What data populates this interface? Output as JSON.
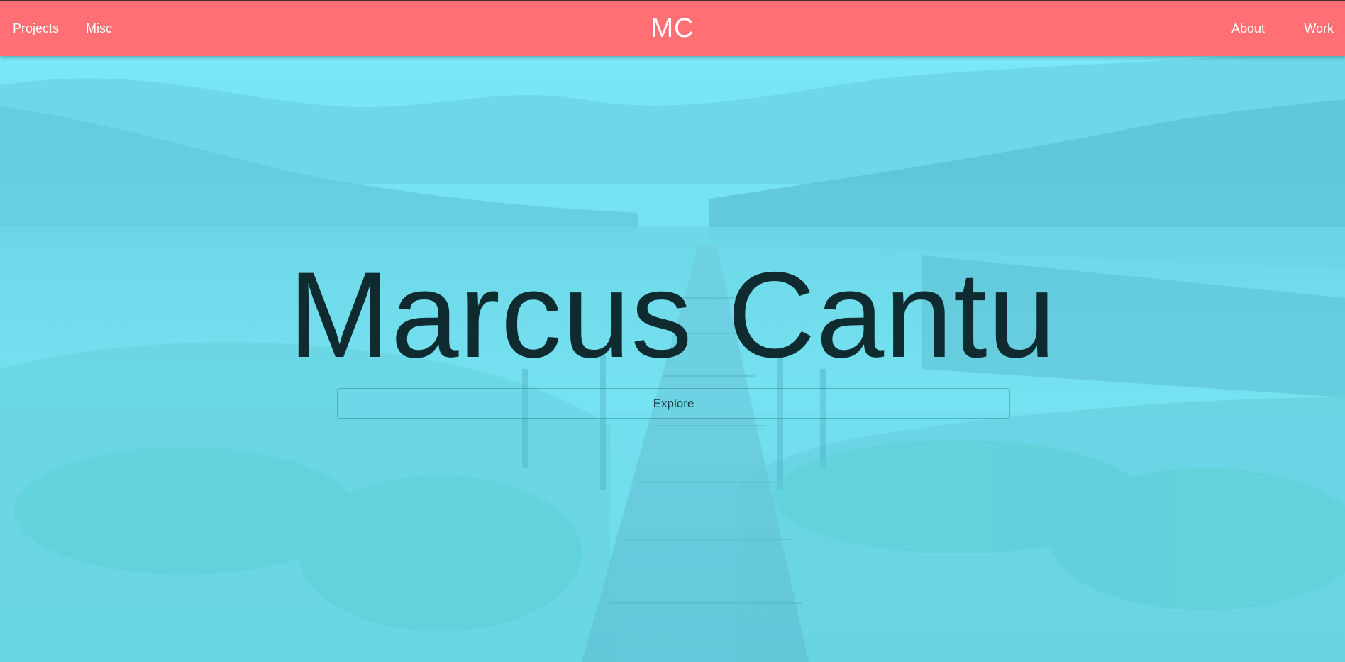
{
  "navbar": {
    "brand": "MC",
    "left_links": [
      {
        "label": "Projects"
      },
      {
        "label": "Misc"
      }
    ],
    "right_links": [
      {
        "label": "About"
      },
      {
        "label": "Work"
      }
    ]
  },
  "hero": {
    "title": "Marcus Cantu",
    "button_label": "Explore"
  },
  "colors": {
    "navbar": "#ff6f73",
    "overlay": "#74e1f1",
    "title_text": "#0f2b30"
  }
}
